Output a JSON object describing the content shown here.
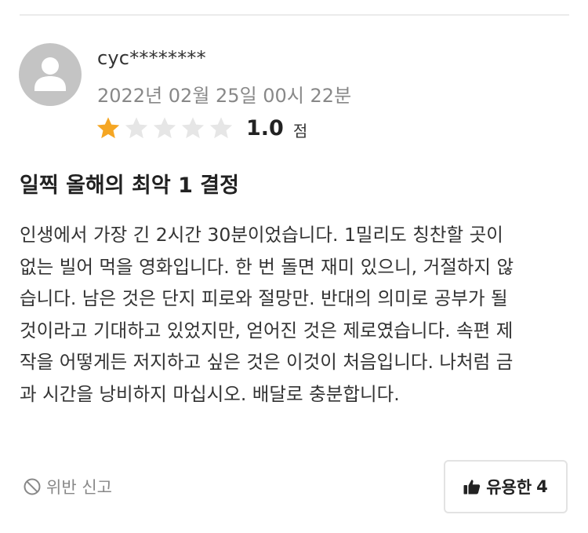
{
  "review": {
    "username": "cyc********",
    "date": "2022년 02월 25일 00시 22분",
    "rating": {
      "score_text": "1.0",
      "unit": "점",
      "filled_stars": 1,
      "total_stars": 5,
      "fill_fraction": 0.2
    },
    "title": "일찍 올해의 최악 1 결정",
    "body_lines": [
      "인생에서 가장 긴 2시간 30분이었습니다. 1밀리도 칭찬할 곳이",
      "없는 빌어 먹을 영화입니다. 한 번 돌면 재미 있으니, 거절하지 않",
      "습니다. 남은 것은 단지 피로와 절망만. 반대의 의미로 공부가 될",
      "것이라고 기대하고 있었지만, 얻어진 것은 제로였습니다. 속편 제",
      "작을 어떻게든 저지하고 싶은 것은 이것이 처음입니다. 나처럼 금",
      "과 시간을 낭비하지 마십시오. 배달로 충분합니다."
    ]
  },
  "actions": {
    "report_label": "위반 신고",
    "helpful_label": "유용한",
    "helpful_count": "4"
  },
  "icons": {
    "avatar": "user-silhouette-icon",
    "star": "star-icon",
    "report": "prohibited-icon",
    "helpful": "thumbs-up-icon"
  },
  "colors": {
    "star_filled": "#f5a623",
    "star_empty": "#e6e6e6",
    "avatar_bg": "#c4c4c4",
    "muted_text": "#888888"
  }
}
